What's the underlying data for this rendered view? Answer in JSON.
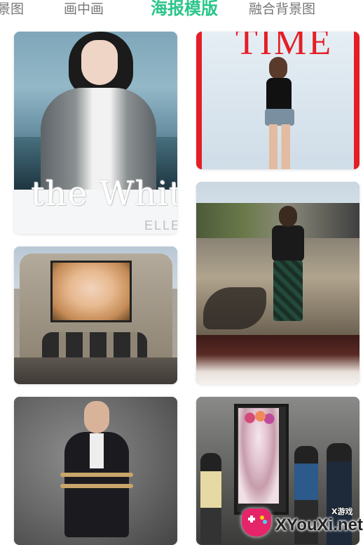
{
  "tabs": [
    {
      "label": "景图",
      "active": false
    },
    {
      "label": "画中画",
      "active": false
    },
    {
      "label": "海报模版",
      "active": true
    },
    {
      "label": "融合背景图",
      "active": false
    }
  ],
  "accent_color": "#2bc58a",
  "templates": [
    {
      "id": "card-1",
      "texts": [
        "the Whit",
        "ELLE"
      ]
    },
    {
      "id": "card-2",
      "texts": [
        "TIME"
      ]
    },
    {
      "id": "card-3",
      "texts": []
    },
    {
      "id": "card-4",
      "texts": []
    },
    {
      "id": "card-5",
      "texts": []
    },
    {
      "id": "card-6",
      "texts": []
    }
  ],
  "watermark": {
    "small": "X游戏",
    "site": "XYouXi.net"
  }
}
